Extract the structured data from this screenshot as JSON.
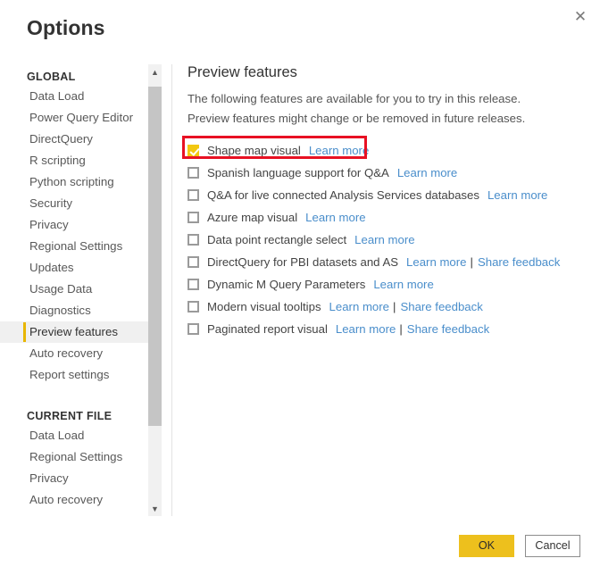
{
  "dialog": {
    "title": "Options",
    "close_icon": "close-icon"
  },
  "sidebar": {
    "groups": [
      {
        "header": "GLOBAL",
        "items": [
          {
            "label": "Data Load",
            "selected": false
          },
          {
            "label": "Power Query Editor",
            "selected": false
          },
          {
            "label": "DirectQuery",
            "selected": false
          },
          {
            "label": "R scripting",
            "selected": false
          },
          {
            "label": "Python scripting",
            "selected": false
          },
          {
            "label": "Security",
            "selected": false
          },
          {
            "label": "Privacy",
            "selected": false
          },
          {
            "label": "Regional Settings",
            "selected": false
          },
          {
            "label": "Updates",
            "selected": false
          },
          {
            "label": "Usage Data",
            "selected": false
          },
          {
            "label": "Diagnostics",
            "selected": false
          },
          {
            "label": "Preview features",
            "selected": true
          },
          {
            "label": "Auto recovery",
            "selected": false
          },
          {
            "label": "Report settings",
            "selected": false
          }
        ]
      },
      {
        "header": "CURRENT FILE",
        "items": [
          {
            "label": "Data Load",
            "selected": false
          },
          {
            "label": "Regional Settings",
            "selected": false
          },
          {
            "label": "Privacy",
            "selected": false
          },
          {
            "label": "Auto recovery",
            "selected": false
          }
        ]
      }
    ],
    "scrollbar": {
      "up_icon": "chevron-up-icon",
      "down_icon": "chevron-down-icon"
    }
  },
  "main": {
    "heading": "Preview features",
    "description": "The following features are available for you to try in this release. Preview features might change or be removed in future releases.",
    "features": [
      {
        "label": "Shape map visual",
        "checked": true,
        "highlighted": true,
        "links": [
          "Learn more"
        ]
      },
      {
        "label": "Spanish language support for Q&A",
        "checked": false,
        "highlighted": false,
        "links": [
          "Learn more"
        ]
      },
      {
        "label": "Q&A for live connected Analysis Services databases",
        "checked": false,
        "highlighted": false,
        "links": [
          "Learn more"
        ]
      },
      {
        "label": "Azure map visual",
        "checked": false,
        "highlighted": false,
        "links": [
          "Learn more"
        ]
      },
      {
        "label": "Data point rectangle select",
        "checked": false,
        "highlighted": false,
        "links": [
          "Learn more"
        ]
      },
      {
        "label": "DirectQuery for PBI datasets and AS",
        "checked": false,
        "highlighted": false,
        "links": [
          "Learn more",
          "Share feedback"
        ]
      },
      {
        "label": "Dynamic M Query Parameters",
        "checked": false,
        "highlighted": false,
        "links": [
          "Learn more"
        ]
      },
      {
        "label": "Modern visual tooltips",
        "checked": false,
        "highlighted": false,
        "links": [
          "Learn more",
          "Share feedback"
        ]
      },
      {
        "label": "Paginated report visual",
        "checked": false,
        "highlighted": false,
        "links": [
          "Learn more",
          "Share feedback"
        ]
      }
    ],
    "link_separator": "|"
  },
  "footer": {
    "ok_label": "OK",
    "cancel_label": "Cancel"
  },
  "colors": {
    "accent_yellow": "#f2c811",
    "ok_button": "#edc01d",
    "link_blue": "#4a8ecb",
    "highlight_red": "#e81123",
    "selected_bar": "#e8b600"
  }
}
